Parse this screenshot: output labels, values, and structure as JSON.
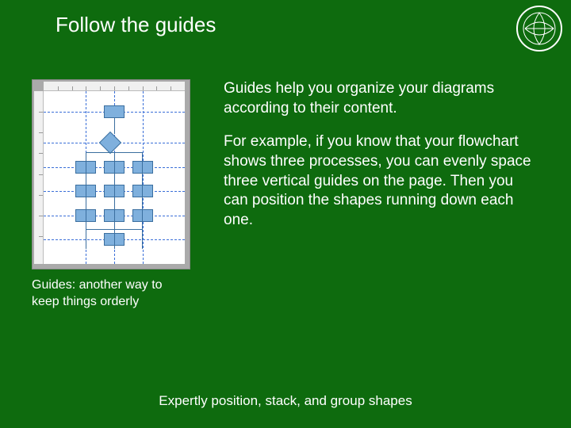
{
  "title": "Follow the guides",
  "caption": "Guides: another way to keep things orderly",
  "paragraph1": "Guides help you organize your diagrams according to their content.",
  "paragraph2": "For example, if you know that your flowchart shows three processes, you can evenly space three vertical guides on the page. Then you can position the shapes running down each one.",
  "footer": "Expertly position, stack, and group shapes"
}
